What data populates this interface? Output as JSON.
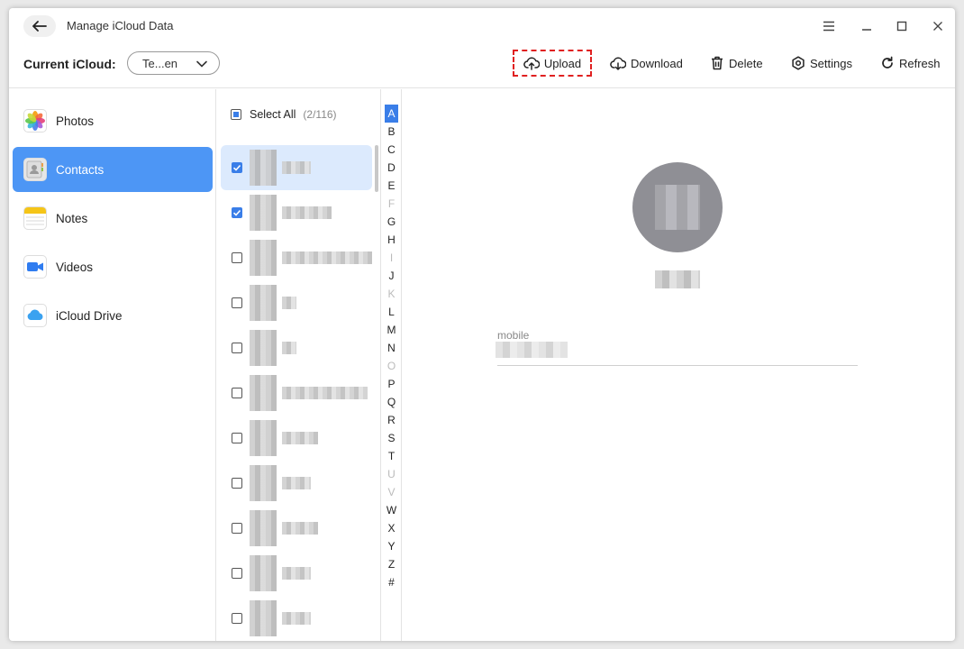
{
  "window": {
    "title": "Manage iCloud Data"
  },
  "toolbar": {
    "current_label": "Current iCloud:",
    "account_value": "Te...en",
    "buttons": {
      "upload": "Upload",
      "download": "Download",
      "delete": "Delete",
      "settings": "Settings",
      "refresh": "Refresh"
    }
  },
  "sidebar": {
    "items": [
      {
        "label": "Photos",
        "icon": "photos-icon"
      },
      {
        "label": "Contacts",
        "icon": "contacts-icon",
        "active": true
      },
      {
        "label": "Notes",
        "icon": "notes-icon"
      },
      {
        "label": "Videos",
        "icon": "videos-icon"
      },
      {
        "label": "iCloud Drive",
        "icon": "icloud-drive-icon"
      }
    ]
  },
  "list": {
    "select_all_label": "Select All",
    "count": "(2/116)",
    "rows": [
      {
        "checked": true,
        "active": true
      },
      {
        "checked": true
      },
      {
        "checked": false
      },
      {
        "checked": false
      },
      {
        "checked": false
      },
      {
        "checked": false
      },
      {
        "checked": false
      },
      {
        "checked": false
      },
      {
        "checked": false
      },
      {
        "checked": false
      },
      {
        "checked": false
      }
    ]
  },
  "alphabet": {
    "letters": [
      "A",
      "B",
      "C",
      "D",
      "E",
      "F",
      "G",
      "H",
      "I",
      "J",
      "K",
      "L",
      "M",
      "N",
      "O",
      "P",
      "Q",
      "R",
      "S",
      "T",
      "U",
      "V",
      "W",
      "X",
      "Y",
      "Z",
      "#"
    ],
    "dimmed": [
      "F",
      "I",
      "K",
      "O",
      "U",
      "V"
    ],
    "active": "A"
  },
  "detail": {
    "field_label": "mobile"
  },
  "colors": {
    "accent": "#4d96f5",
    "highlight_border": "#e02020"
  }
}
